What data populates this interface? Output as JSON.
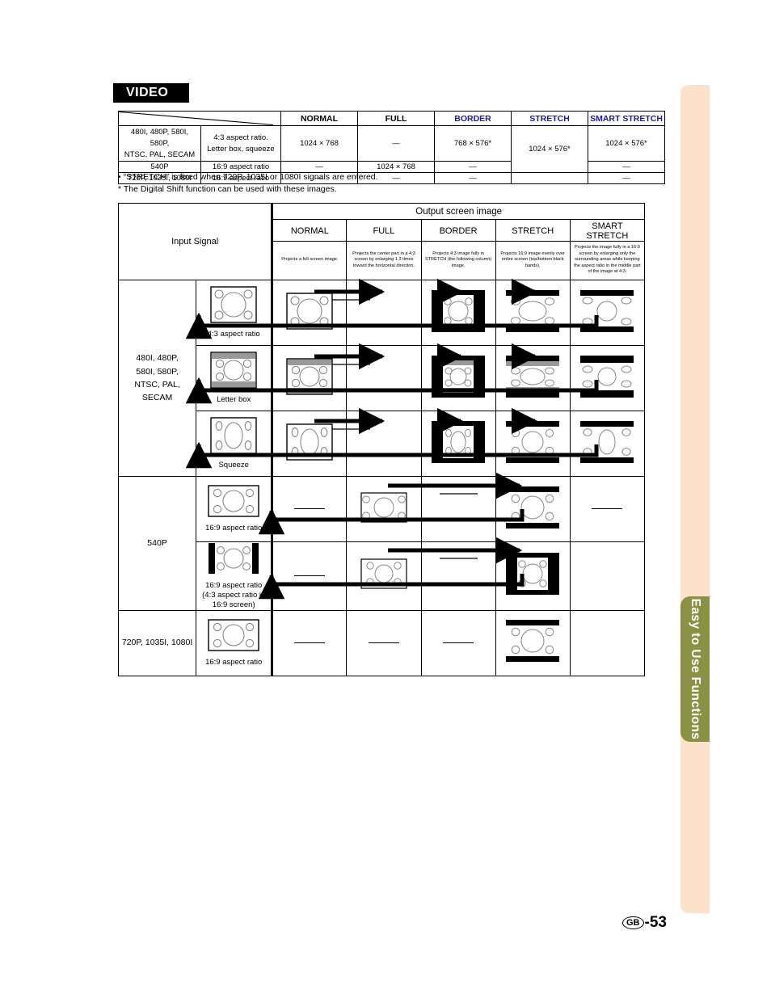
{
  "page": {
    "section_heading": "VIDEO",
    "footer_region": "GB",
    "footer_page": "-53",
    "side_tab_label": "Easy to Use Functions"
  },
  "summary_table": {
    "columns": [
      "NORMAL",
      "FULL",
      "BORDER",
      "STRETCH",
      "SMART STRETCH"
    ],
    "column_colors": [
      "#000000",
      "#000000",
      "#1a1aa8",
      "#1a1aa8",
      "#1a1aa8"
    ],
    "rows": [
      {
        "signal_line1": "480I, 480P, 580I, 580P,",
        "signal_line2": "NTSC, PAL, SECAM",
        "aspect_line1": "4:3 aspect ratio.",
        "aspect_line2": "Letter box, squeeze",
        "normal": "1024 × 768",
        "full": "—",
        "border": "768 × 576*",
        "stretch": "1024 × 576*",
        "smart_stretch": "1024 × 576*"
      },
      {
        "signal_line1": "540P",
        "signal_line2": "",
        "aspect_line1": "16:9 aspect ratio",
        "aspect_line2": "",
        "normal": "—",
        "full": "1024 × 768",
        "border": "—",
        "stretch": "",
        "smart_stretch": "—"
      },
      {
        "signal_line1": "720P, 1035I, 1080I",
        "signal_line2": "",
        "aspect_line1": "16:9 aspect ratio",
        "aspect_line2": "",
        "normal": "—",
        "full": "—",
        "border": "—",
        "stretch": "",
        "smart_stretch": "—"
      }
    ]
  },
  "notes": {
    "bullet": "• “STRETCH” is fixed when 720P, 1035I or 1080I signals are entered.",
    "asterisk": "* The Digital Shift function can be used with these images."
  },
  "main_table": {
    "input_signal_header": "Input Signal",
    "output_header": "Output screen image",
    "modes": [
      {
        "name": "NORMAL",
        "description": "Projects a full screen image."
      },
      {
        "name": "FULL",
        "description": "Projects the center part in a 4:3 screen by enlarging 1.3 times toward the horizontal direction."
      },
      {
        "name": "BORDER",
        "description": "Projects 4:3 image fully in STRETCH (the following column) image."
      },
      {
        "name": "STRETCH",
        "description": "Projects 16:9 image evenly over entire screen (top/bottom black bands)."
      },
      {
        "name": "SMART STRETCH",
        "description": "Projects the image fully in a 16:9 screen by enlarging only the surrounding areas while keeping the aspect ratio in the middle part of the image at 4:3."
      }
    ],
    "signal_groups": [
      {
        "label_lines": [
          "480I, 480P,",
          "580I, 580P,",
          "NTSC, PAL, SECAM"
        ],
        "rows": [
          {
            "input_caption_lines": [
              "4:3 aspect ratio"
            ],
            "input_icon": "screen-4x3",
            "outputs": [
              "screen-4x3",
              "dash",
              "screen-border-4x3",
              "screen-stretch-4x3",
              "screen-smart-4x3"
            ]
          },
          {
            "input_caption_lines": [
              "Letter box"
            ],
            "input_icon": "screen-letterbox",
            "outputs": [
              "screen-letterbox",
              "dash",
              "screen-border-letterbox",
              "screen-stretch-letterbox",
              "screen-smart-letterbox"
            ]
          },
          {
            "input_caption_lines": [
              "Squeeze"
            ],
            "input_icon": "screen-squeeze",
            "outputs": [
              "screen-squeeze",
              "dash",
              "screen-border-squeeze",
              "screen-stretch-squeeze",
              "screen-smart-squeeze"
            ]
          }
        ]
      },
      {
        "label_lines": [
          "540P"
        ],
        "rows": [
          {
            "input_caption_lines": [
              "16:9 aspect ratio"
            ],
            "input_icon": "screen-16x9",
            "outputs": [
              "dash",
              "screen-16x9-small",
              "blank",
              "screen-stretch-16x9",
              "dash"
            ]
          },
          {
            "input_caption_lines": [
              "16:9 aspect ratio",
              "(4:3 aspect ratio in",
              "16:9 screen)"
            ],
            "input_icon": "screen-16x9-pillar",
            "outputs": [
              "dash",
              "screen-16x9-pillar-small",
              "blank",
              "screen-border-16x9",
              "blank"
            ]
          }
        ]
      },
      {
        "label_lines": [
          "720P, 1035I, 1080I"
        ],
        "rows": [
          {
            "input_caption_lines": [
              "16:9 aspect ratio"
            ],
            "input_icon": "screen-16x9",
            "outputs": [
              "dash",
              "dash",
              "dash",
              "screen-stretch-16x9",
              "blank"
            ]
          }
        ]
      }
    ]
  }
}
